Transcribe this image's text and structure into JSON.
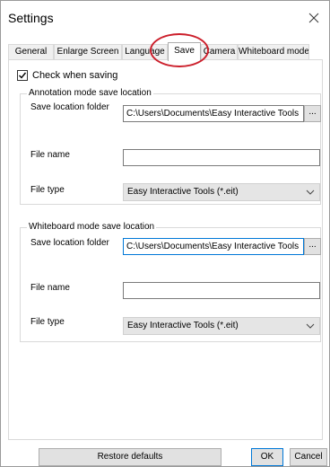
{
  "window": {
    "title": "Settings"
  },
  "tabs": [
    {
      "label": "General",
      "active": false
    },
    {
      "label": "Enlarge Screen",
      "active": false
    },
    {
      "label": "Language",
      "active": false
    },
    {
      "label": "Save",
      "active": true
    },
    {
      "label": "Camera",
      "active": false
    },
    {
      "label": "Whiteboard mode",
      "active": false
    }
  ],
  "save_tab": {
    "check_when_saving": {
      "label": "Check when saving",
      "checked": true
    },
    "annotation_group": {
      "legend": "Annotation mode save location",
      "folder_label": "Save location folder",
      "folder_value": "C:\\Users\\Documents\\Easy Interactive Tools",
      "browse_label": "...",
      "file_name_label": "File name",
      "file_name_value": "",
      "file_type_label": "File type",
      "file_type_value": "Easy Interactive Tools (*.eit)"
    },
    "whiteboard_group": {
      "legend": "Whiteboard mode save location",
      "folder_label": "Save location folder",
      "folder_value": "C:\\Users\\Documents\\Easy Interactive Tools",
      "browse_label": "...",
      "file_name_label": "File name",
      "file_name_value": "",
      "file_type_label": "File type",
      "file_type_value": "Easy Interactive Tools (*.eit)"
    }
  },
  "footer": {
    "restore_defaults_label": "Restore defaults",
    "ok_label": "OK",
    "cancel_label": "Cancel"
  },
  "colors": {
    "highlight": "#cc1f2b",
    "focus": "#0078d7"
  },
  "icons": {
    "close": "close-icon",
    "checkmark": "checkmark-icon",
    "dropdown": "chevron-down-icon"
  }
}
